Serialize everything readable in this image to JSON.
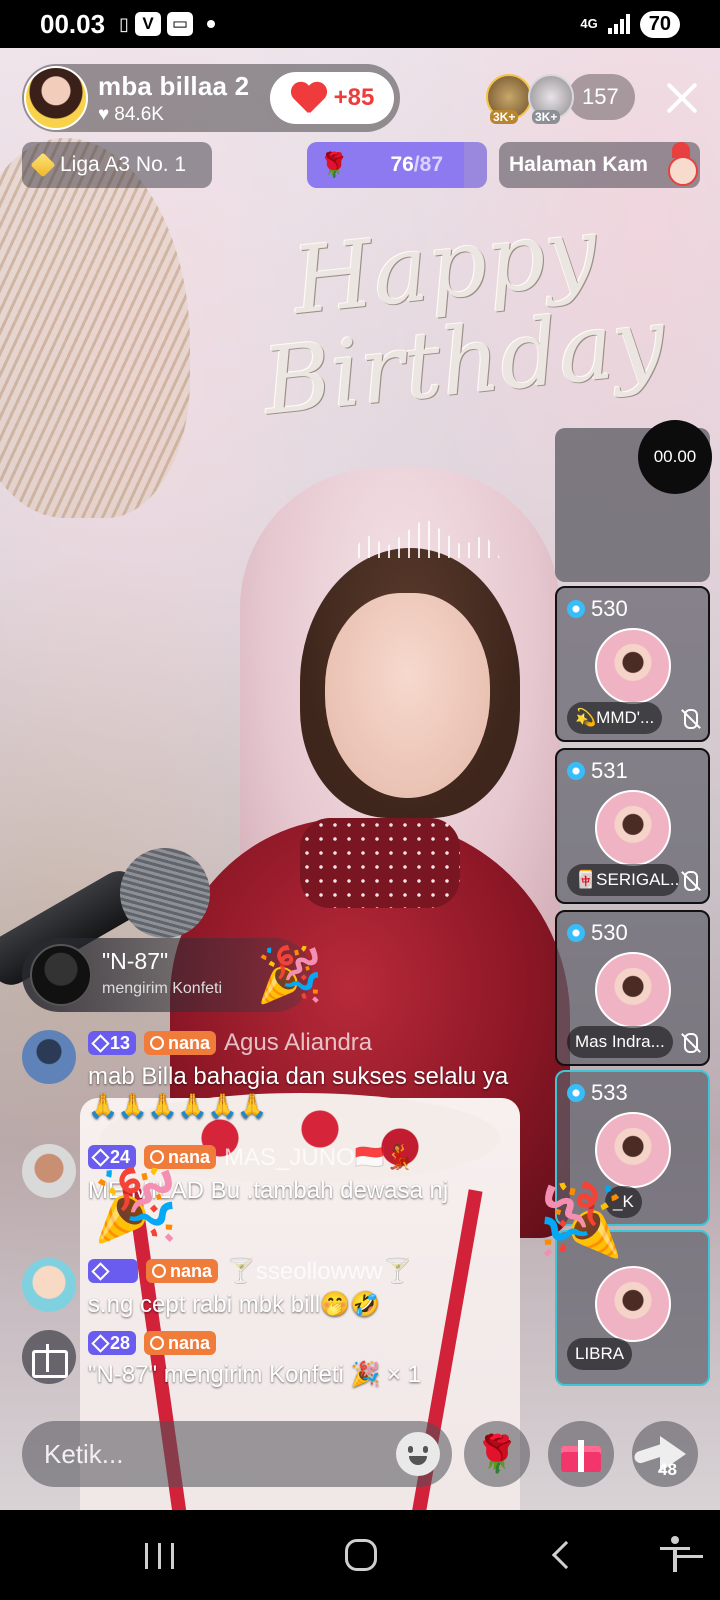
{
  "status_bar": {
    "time": "00.03",
    "icons": [
      "vibrate-icon",
      "v-app-icon",
      "chat-app-icon",
      "dot"
    ],
    "network": "4G",
    "battery": "70"
  },
  "host": {
    "name": "mba billaa 2",
    "likes": "84.6K",
    "follow_label": "+85"
  },
  "viewers": {
    "badge_1": "3K+",
    "badge_2": "3K+",
    "count": "157"
  },
  "league": {
    "label": "Liga A3 No. 1"
  },
  "gift_goal": {
    "current": "76",
    "separator": "/",
    "total": "87",
    "progress": 0.874
  },
  "page_link": {
    "label": "Halaman Kam"
  },
  "mini_video": {
    "timer": "00.00"
  },
  "guests": [
    {
      "score": "530",
      "name": "💫MMD'...",
      "muted": true
    },
    {
      "score": "531",
      "name": "🀄SERIGAL...",
      "muted": true
    },
    {
      "score": "530",
      "name": "Mas Indra...",
      "muted": true
    },
    {
      "score": "533",
      "name": "_K",
      "muted": false
    },
    {
      "score": "",
      "name": "LIBRA",
      "muted": false
    }
  ],
  "gift_notice": {
    "user": "\"N-87\"",
    "action": "mengirim Konfeti"
  },
  "chat": [
    {
      "level": "13",
      "fan_tag": "nana",
      "name": "Agus Aliandra",
      "text": "mab Billa bahagia dan sukses selalu ya 🙏🙏🙏🙏🙏🙏"
    },
    {
      "level": "24",
      "fan_tag": "nana",
      "name": "MAS_JUNO🇮🇩💃",
      "text": "ME MILAD Bu .tambah dewasa nj"
    },
    {
      "level": "",
      "fan_tag": "nana",
      "name": "🍸sseollowww🍸",
      "text": "s.ng cept rabi mbk bill🤭🤣"
    },
    {
      "level": "28",
      "fan_tag": "nana",
      "name": "",
      "text": "\"N-87\" mengirim Konfeti 🎉 × 1"
    }
  ],
  "bottom_bar": {
    "input_placeholder": "Ketik...",
    "share_count": "48"
  }
}
